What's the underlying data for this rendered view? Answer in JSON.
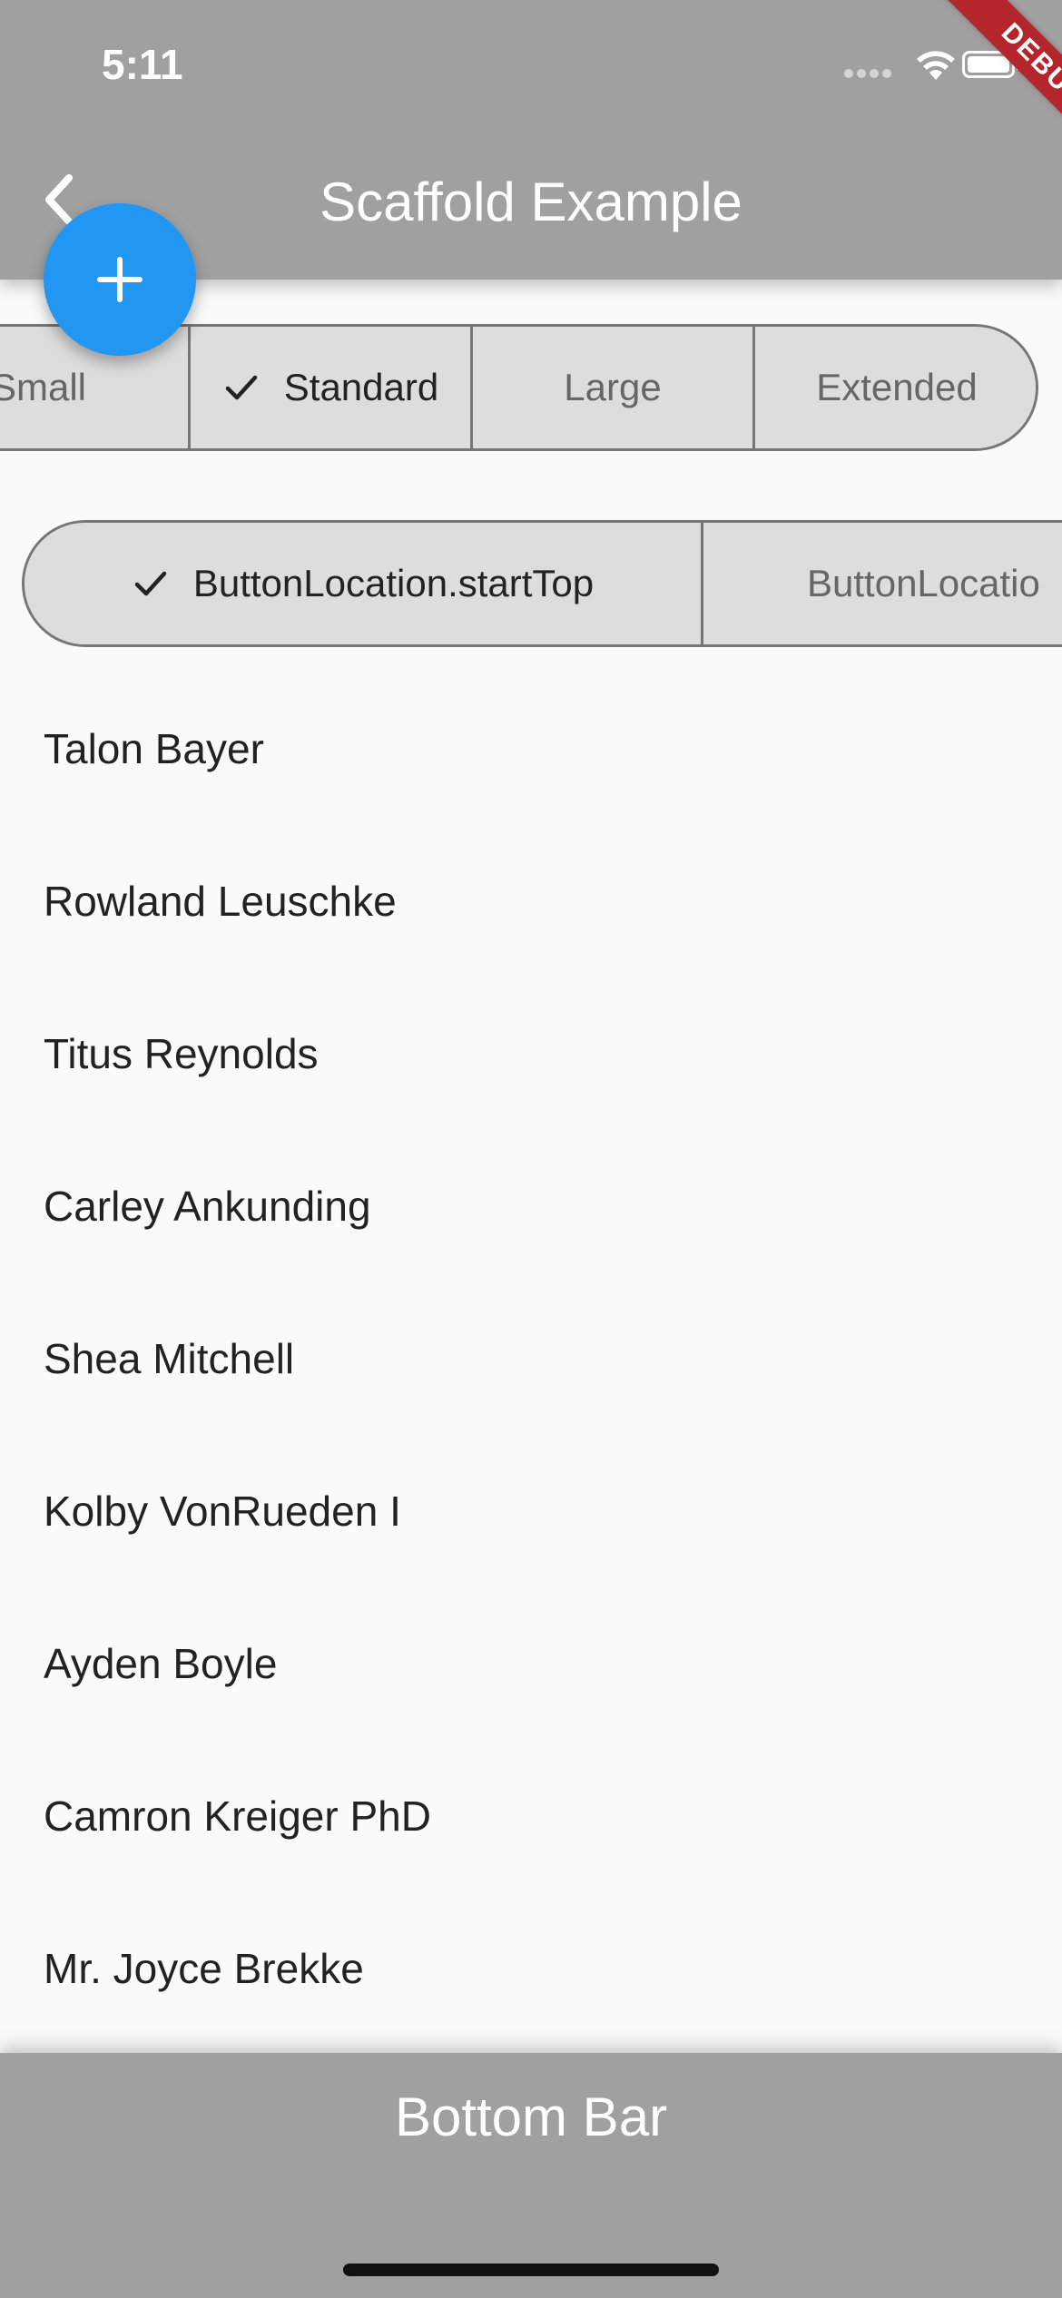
{
  "status_bar": {
    "time": "5:11",
    "icons": [
      "signal-icon",
      "wifi-icon",
      "battery-icon"
    ]
  },
  "app_bar": {
    "title": "Scaffold Example",
    "back_icon": "chevron-left-icon",
    "background": "#a0a0a0"
  },
  "debug_banner": {
    "label": "DEBUG",
    "color": "#b4252c"
  },
  "fab": {
    "icon": "plus-icon",
    "color": "#2196f3"
  },
  "size_selector": {
    "options": [
      {
        "label": "Small",
        "selected": false
      },
      {
        "label": "Standard",
        "selected": true
      },
      {
        "label": "Large",
        "selected": false
      },
      {
        "label": "Extended",
        "selected": false
      }
    ]
  },
  "location_selector": {
    "options": [
      {
        "label": "ButtonLocation.startTop",
        "selected": true
      },
      {
        "label": "ButtonLocatio",
        "selected": false
      }
    ]
  },
  "list": {
    "items": [
      "Talon Bayer",
      "Rowland Leuschke",
      "Titus Reynolds",
      "Carley Ankunding",
      "Shea Mitchell",
      "Kolby VonRueden I",
      "Ayden Boyle",
      "Camron Kreiger PhD",
      "Mr. Joyce Brekke"
    ]
  },
  "bottom_bar": {
    "title": "Bottom Bar",
    "background": "#a0a0a0"
  }
}
